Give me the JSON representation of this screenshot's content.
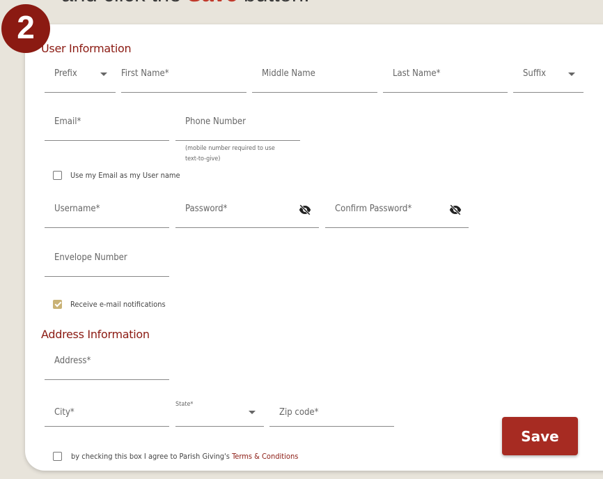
{
  "instruction": {
    "prefix": "and click the ",
    "highlight": "Save",
    "suffix": " button."
  },
  "step_badge": "2",
  "user_info": {
    "title": "User Information",
    "prefix_label": "Prefix",
    "first_name_label": "First Name*",
    "middle_name_label": "Middle Name",
    "last_name_label": "Last Name*",
    "suffix_label": "Suffix",
    "email_label": "Email*",
    "phone_label": "Phone Number",
    "phone_helper_1": "(mobile number required to use",
    "phone_helper_2": "text-to-give)",
    "use_email_label": "Use my Email as my User name",
    "use_email_checked": false,
    "username_label": "Username*",
    "password_label": "Password*",
    "confirm_password_label": "Confirm Password*",
    "envelope_label": "Envelope Number",
    "notifications_label": "Receive e-mail notifications",
    "notifications_checked": true
  },
  "address_info": {
    "title": "Address Information",
    "address_label": "Address*",
    "city_label": "City*",
    "state_label": "State*",
    "zip_label": "Zip code*"
  },
  "terms": {
    "text": "by checking this box I agree to Parish Giving's ",
    "link": "Terms & Conditions",
    "checked": false
  },
  "save_label": "Save",
  "colors": {
    "accent": "#8b1a12",
    "button": "#a72b22",
    "checkbox": "#c9b276",
    "background": "#e8e4db"
  },
  "icons": {
    "password_toggle": "eye-slash-icon",
    "dropdown": "chevron-down-icon"
  }
}
